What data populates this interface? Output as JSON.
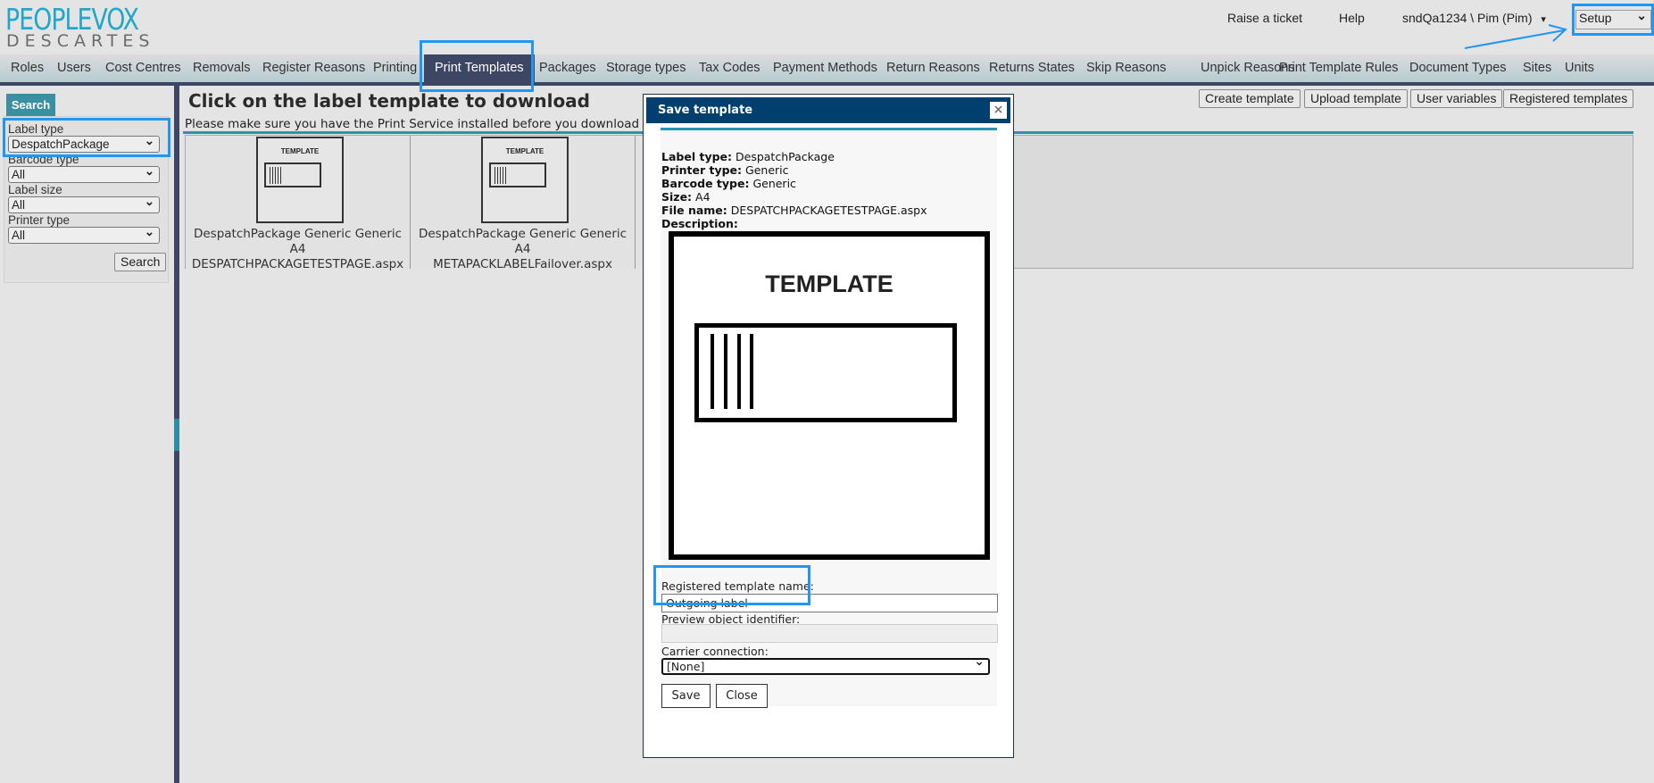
{
  "logo": {
    "line1": "PEOPLEVOX",
    "line2": "DESCARTES"
  },
  "header": {
    "raise_ticket": "Raise a ticket",
    "help": "Help",
    "user": "sndQa1234 \\ Pim (Pim)",
    "user_caret": "▾",
    "setup_select": "Setup"
  },
  "nav": [
    "Roles",
    "Users",
    "Cost Centres",
    "Removals",
    "Register Reasons",
    "Printing",
    "Print Templates",
    "Packages",
    "Storage types",
    "Tax Codes",
    "Payment Methods",
    "Return Reasons",
    "Returns States",
    "Skip Reasons",
    "Unpick Reasons",
    "Print Template Rules",
    "Document Types",
    "Sites",
    "Units"
  ],
  "nav_active": "Print Templates",
  "sidebar": {
    "tab": "Search",
    "filters": [
      {
        "label": "Label type",
        "value": "DespatchPackage"
      },
      {
        "label": "Barcode type",
        "value": "All"
      },
      {
        "label": "Label size",
        "value": "All"
      },
      {
        "label": "Printer type",
        "value": "All"
      }
    ],
    "search_button": "Search"
  },
  "main": {
    "title": "Click on the label template to download",
    "note": "Please make sure you have the Print Service installed before you download these lab",
    "buttons": [
      "Create template",
      "Upload template",
      "User variables",
      "Registered templates"
    ],
    "templates": [
      {
        "thumb_text": "TEMPLATE",
        "line1": "DespatchPackage Generic Generic A4",
        "line2": "DESPATCHPACKAGETESTPAGE.aspx"
      },
      {
        "thumb_text": "TEMPLATE",
        "line1": "DespatchPackage Generic Generic A4",
        "line2": "METAPACKLABELFailover.aspx"
      }
    ]
  },
  "dialog": {
    "title": "Save template",
    "close": "×",
    "info": [
      {
        "k": "Label type:",
        "v": "DespatchPackage"
      },
      {
        "k": "Printer type:",
        "v": "Generic"
      },
      {
        "k": "Barcode type:",
        "v": "Generic"
      },
      {
        "k": "Size:",
        "v": "A4"
      },
      {
        "k": "File name:",
        "v": "DESPATCHPACKAGETESTPAGE.aspx"
      },
      {
        "k": "Description:",
        "v": ""
      }
    ],
    "preview_text": "TEMPLATE",
    "registered_name_label": "Registered template name:",
    "registered_name_value": "Outgoing label",
    "preview_id_label": "Preview object identifier:",
    "preview_id_value": "",
    "carrier_label": "Carrier connection:",
    "carrier_value": "[None]",
    "save": "Save",
    "close_button": "Close"
  },
  "colors": {
    "brand_teal": "#1fa8c9",
    "nav_active": "#3d4663",
    "dialog_title": "#003f6e",
    "highlight": "#2196f3"
  }
}
